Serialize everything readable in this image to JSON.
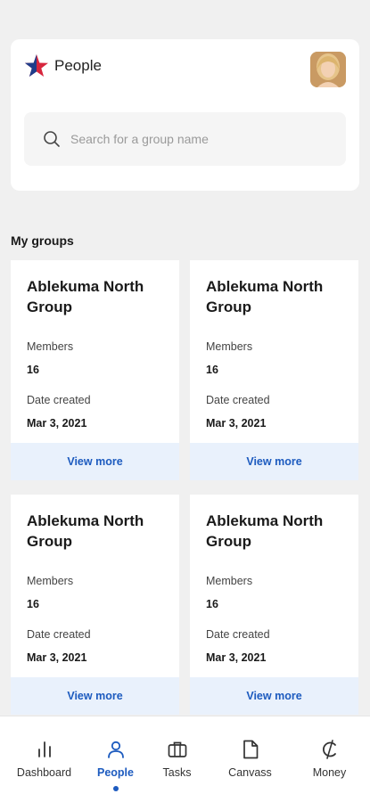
{
  "header": {
    "title": "People",
    "logo_icon": "star-logo-icon",
    "avatar_icon": "user-avatar"
  },
  "search": {
    "placeholder": "Search for a group name",
    "value": ""
  },
  "my_groups": {
    "title": "My groups",
    "cards": [
      {
        "name": "Ablekuma North Group",
        "members_label": "Members",
        "members": "16",
        "date_label": "Date created",
        "date": "Mar 3, 2021",
        "action": "View more"
      },
      {
        "name": "Ablekuma North Group",
        "members_label": "Members",
        "members": "16",
        "date_label": "Date created",
        "date": "Mar 3, 2021",
        "action": "View more"
      },
      {
        "name": "Ablekuma North Group",
        "members_label": "Members",
        "members": "16",
        "date_label": "Date created",
        "date": "Mar 3, 2021",
        "action": "View more"
      },
      {
        "name": "Ablekuma North Group",
        "members_label": "Members",
        "members": "16",
        "date_label": "Date created",
        "date": "Mar 3, 2021",
        "action": "View more"
      }
    ]
  },
  "nav": {
    "items": [
      {
        "label": "Dashboard",
        "icon": "bar-chart-icon"
      },
      {
        "label": "People",
        "icon": "person-icon",
        "active": true
      },
      {
        "label": "Tasks",
        "icon": "briefcase-icon"
      },
      {
        "label": "Canvass",
        "icon": "document-icon"
      },
      {
        "label": "Money",
        "icon": "cedi-icon"
      }
    ]
  },
  "colors": {
    "accent": "#1d5bbf",
    "star_red": "#d7263d",
    "star_blue": "#1f3d8a",
    "view_more_bg": "#e9f1fc",
    "page_bg": "#f0f0f0"
  }
}
